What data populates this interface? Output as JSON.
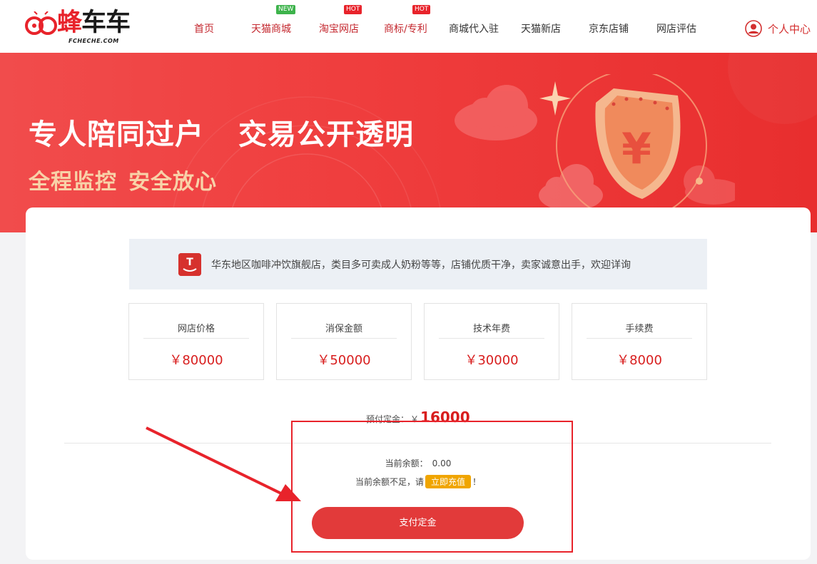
{
  "brand": {
    "name_part1": "蜂",
    "name_part2": "车车",
    "sub": "FCHECHE.COM"
  },
  "nav": {
    "items": [
      {
        "label": "首页",
        "badge": ""
      },
      {
        "label": "天猫商城",
        "badge": "NEW"
      },
      {
        "label": "淘宝网店",
        "badge": "HOT"
      },
      {
        "label": "商标/专利",
        "badge": "HOT"
      },
      {
        "label": "商城代入驻",
        "badge": ""
      },
      {
        "label": "天猫新店",
        "badge": ""
      },
      {
        "label": "京东店铺",
        "badge": ""
      },
      {
        "label": "网店评估",
        "badge": ""
      }
    ],
    "user_label": "个人中心"
  },
  "banner": {
    "line1_a": "专人陪同过户",
    "line1_b": "交易公开透明",
    "line2_a": "全程监控",
    "line2_b": "安全放心",
    "shield_symbol": "¥"
  },
  "shop": {
    "description": "华东地区咖啡冲饮旗舰店，类目多可卖成人奶粉等等，店铺优质干净，卖家诚意出手，欢迎详询",
    "icon_letter": "T"
  },
  "fees": [
    {
      "label": "网店价格",
      "value": "￥80000"
    },
    {
      "label": "消保金额",
      "value": "￥50000"
    },
    {
      "label": "技术年费",
      "value": "￥30000"
    },
    {
      "label": "手续费",
      "value": "￥8000"
    }
  ],
  "deposit": {
    "label": "预付定金：",
    "currency": "￥",
    "value": "16000"
  },
  "balance": {
    "label": "当前余额：",
    "value": "0.00"
  },
  "insufficient": {
    "prefix": "当前余额不足，请",
    "link": "立即充值",
    "suffix": "！"
  },
  "pay_button": "支付定金",
  "colors": {
    "brand_red": "#e8232b",
    "price_red": "#d81e1e",
    "recharge": "#f0a500",
    "new_badge": "#3db34b"
  }
}
